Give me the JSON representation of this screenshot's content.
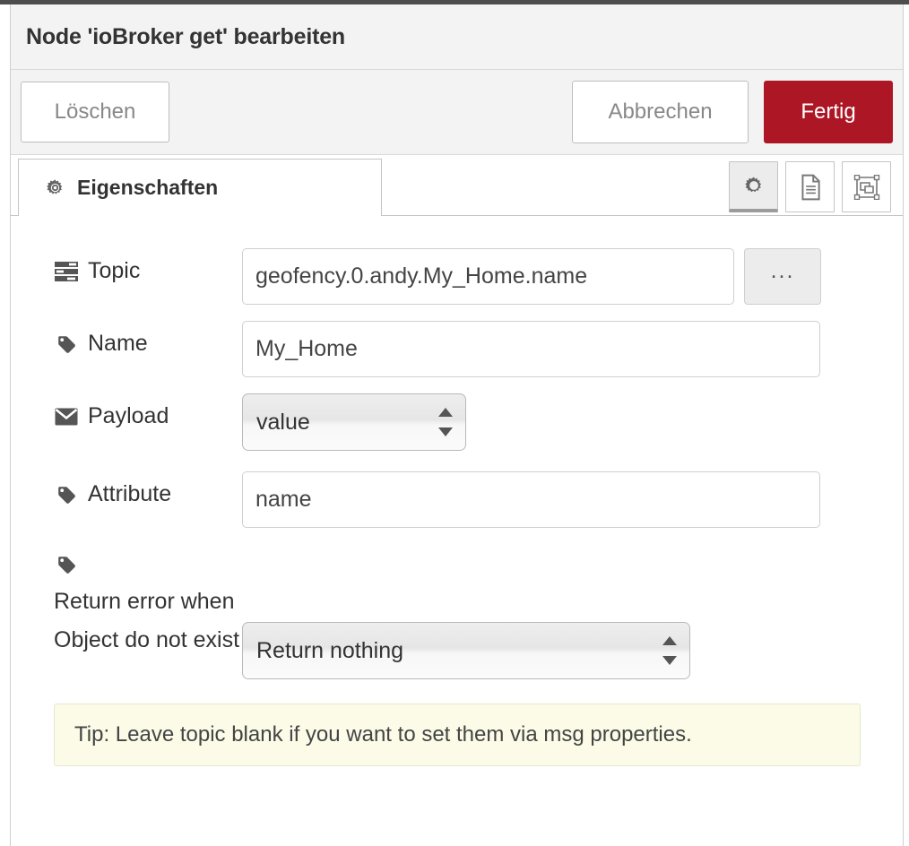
{
  "window": {
    "title": "Node 'ioBroker get' bearbeiten"
  },
  "actions": {
    "delete_label": "Löschen",
    "cancel_label": "Abbrechen",
    "done_label": "Fertig"
  },
  "tabs": [
    {
      "label": "Eigenschaften",
      "icon": "gear-icon",
      "active": true
    }
  ],
  "tool_buttons": [
    {
      "name": "properties-icon",
      "icon": "gear-icon",
      "active": true
    },
    {
      "name": "description-icon",
      "icon": "document-icon",
      "active": false
    },
    {
      "name": "appearance-icon",
      "icon": "appearance-icon",
      "active": false
    }
  ],
  "form": {
    "topic": {
      "label": "Topic",
      "icon": "list-icon",
      "value": "geofency.0.andy.My_Home.name",
      "placeholder": "",
      "browse_label": "..."
    },
    "name": {
      "label": "Name",
      "icon": "tag-icon",
      "value": "My_Home",
      "placeholder": ""
    },
    "payload": {
      "label": "Payload",
      "icon": "envelope-icon",
      "value": "value",
      "options": [
        "value"
      ]
    },
    "attribute": {
      "label": "Attribute",
      "icon": "tag-icon",
      "value": "name",
      "placeholder": ""
    },
    "return_error": {
      "label": "Return error when Object do not exist",
      "icon": "tag-icon",
      "value": "Return nothing",
      "options": [
        "Return nothing"
      ]
    }
  },
  "tip": {
    "text": "Tip: Leave topic blank if you want to set them via msg properties."
  },
  "colors": {
    "accent": "#ad1625",
    "header_bg": "#f3f3f3",
    "tip_bg": "#fbfbe8",
    "text": "#333333",
    "muted_text": "#888888",
    "border": "#cfcfcf"
  }
}
